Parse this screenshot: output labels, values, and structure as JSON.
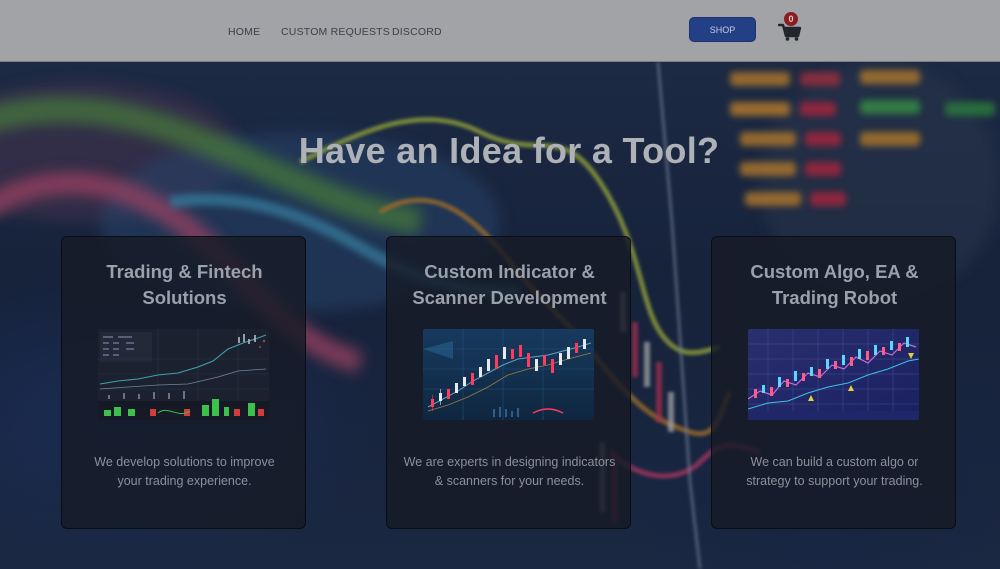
{
  "nav": {
    "links": [
      "HOME",
      "CUSTOM REQUESTS",
      "DISCORD"
    ],
    "shop_label": "SHOP",
    "cart_count": "0"
  },
  "hero": {
    "title": "Have an Idea for a Tool?"
  },
  "cards": [
    {
      "title_line1": "Trading & Fintech",
      "title_line2": "Solutions",
      "desc_line1": "We develop solutions to improve",
      "desc_line2": "your trading experience."
    },
    {
      "title_line1": "Custom Indicator &",
      "title_line2": "Scanner Development",
      "desc_line1": "We are experts in designing indicators",
      "desc_line2": "& scanners for your needs."
    },
    {
      "title_line1": "Custom Algo, EA &",
      "title_line2": "Trading Robot",
      "desc_line1": "We can build a custom algo or",
      "desc_line2": "strategy to support your trading."
    }
  ],
  "icons": {
    "cart": "shopping-cart-icon"
  },
  "colors": {
    "topbar": "#a2a3a7",
    "shop_button": "#233f86",
    "cart_badge": "#8a1d1f",
    "card_bg": "#161b26"
  }
}
